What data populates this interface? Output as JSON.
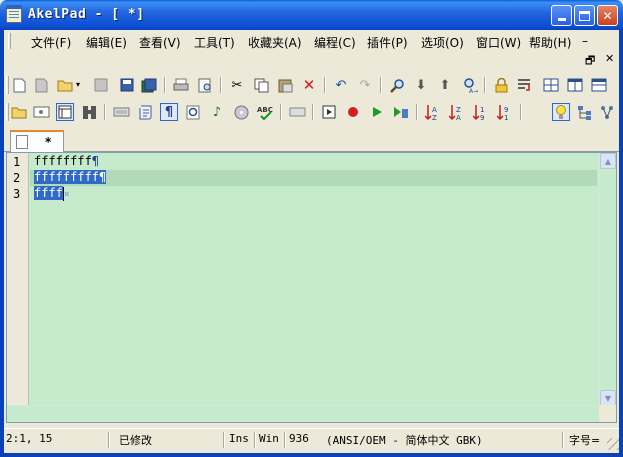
{
  "window": {
    "title": "AkelPad - [ *]"
  },
  "menu": {
    "items": [
      "文件(F)",
      "编辑(E)",
      "查看(V)",
      "工具(T)",
      "收藏夹(A)",
      "编程(C)",
      "插件(P)",
      "选项(O)",
      "窗口(W)",
      "帮助(H)"
    ]
  },
  "mdi": {
    "minimize": "–",
    "restore": "🗗",
    "close": "✕"
  },
  "toolbar1": {
    "icons": [
      "new-file-icon",
      "new-window-icon",
      "open-icon",
      "open-dropdown-icon",
      "save-disabled-icon",
      "save-icon",
      "save-all-icon",
      "print-icon",
      "print-preview-icon",
      "cut-icon",
      "copy-icon",
      "paste-icon",
      "delete-icon",
      "undo-icon",
      "redo-icon",
      "find-icon",
      "find-next-icon",
      "find-prev-icon",
      "replace-icon",
      "lock-icon",
      "wrap-icon",
      "split-h-icon",
      "split-v-icon",
      "split-both-icon"
    ]
  },
  "toolbar2": {
    "icons": [
      "open-folder-icon",
      "view-icon",
      "window-icon",
      "binary-icon",
      "keyboard-icon",
      "script-icon",
      "pilcrow-icon",
      "zoom-icon",
      "music-icon",
      "cd-icon",
      "spell-icon",
      "hex-icon",
      "macro-play-icon",
      "record-icon",
      "play-icon",
      "play-to-end-icon",
      "sort-az-icon",
      "sort-za-icon",
      "sort-num-asc-icon",
      "sort-num-desc-icon",
      "bulb-icon",
      "tree-icon",
      "network-icon"
    ]
  },
  "tab": {
    "label": "*"
  },
  "editor": {
    "line_numbers": [
      "1",
      "2",
      "3"
    ],
    "lines": [
      "ffffffff",
      "fffffffff",
      "ffff"
    ],
    "eol_mark": "¶",
    "eof_mark": "¤",
    "background": "#c6ebcc",
    "selection_color": "#316ac5"
  },
  "status": {
    "position": "2:1, 15",
    "modified": "已修改",
    "insert": "Ins",
    "newline": "Win",
    "codepage": "936",
    "encoding": "(ANSI/OEM - 简体中文 GBK)",
    "font_label": "字号="
  }
}
